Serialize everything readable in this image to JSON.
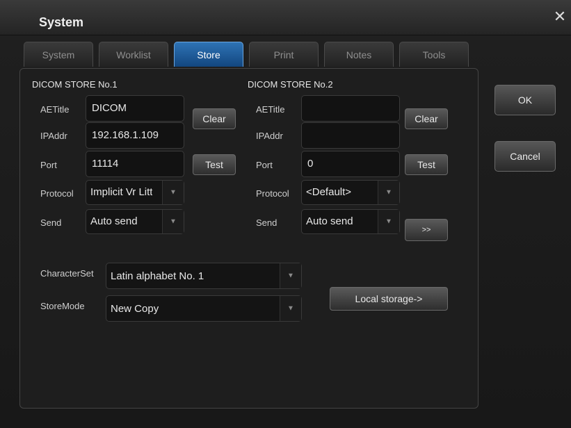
{
  "window": {
    "title": "System",
    "close_symbol": "✕"
  },
  "tabs": [
    {
      "label": "System",
      "active": false
    },
    {
      "label": "Worklist",
      "active": false
    },
    {
      "label": "Store",
      "active": true
    },
    {
      "label": "Print",
      "active": false
    },
    {
      "label": "Notes",
      "active": false
    },
    {
      "label": "Tools",
      "active": false
    }
  ],
  "store1": {
    "title": "DICOM STORE No.1",
    "aetitle_label": "AETitle",
    "aetitle_value": "DICOM",
    "ipaddr_label": "IPAddr",
    "ipaddr_value": "192.168.1.109",
    "port_label": "Port",
    "port_value": "11114",
    "protocol_label": "Protocol",
    "protocol_value": "Implicit Vr Litt",
    "send_label": "Send",
    "send_value": "Auto send",
    "clear_label": "Clear",
    "test_label": "Test"
  },
  "store2": {
    "title": "DICOM STORE No.2",
    "aetitle_label": "AETitle",
    "aetitle_value": "",
    "ipaddr_label": "IPAddr",
    "ipaddr_value": "",
    "port_label": "Port",
    "port_value": "0",
    "protocol_label": "Protocol",
    "protocol_value": "<Default>",
    "send_label": "Send",
    "send_value": "Auto send",
    "clear_label": "Clear",
    "test_label": "Test",
    "more_label": ">>"
  },
  "charset": {
    "label": "CharacterSet",
    "value": "Latin alphabet No. 1"
  },
  "storemode": {
    "label": "StoreMode",
    "value": "New Copy"
  },
  "local_storage_label": "Local storage->",
  "ok_label": "OK",
  "cancel_label": "Cancel",
  "icons": {
    "dropdown": "chevron-down-icon",
    "close": "close-icon"
  },
  "colors": {
    "active_tab": "#1f5c9c",
    "background": "#1e1e1e"
  }
}
